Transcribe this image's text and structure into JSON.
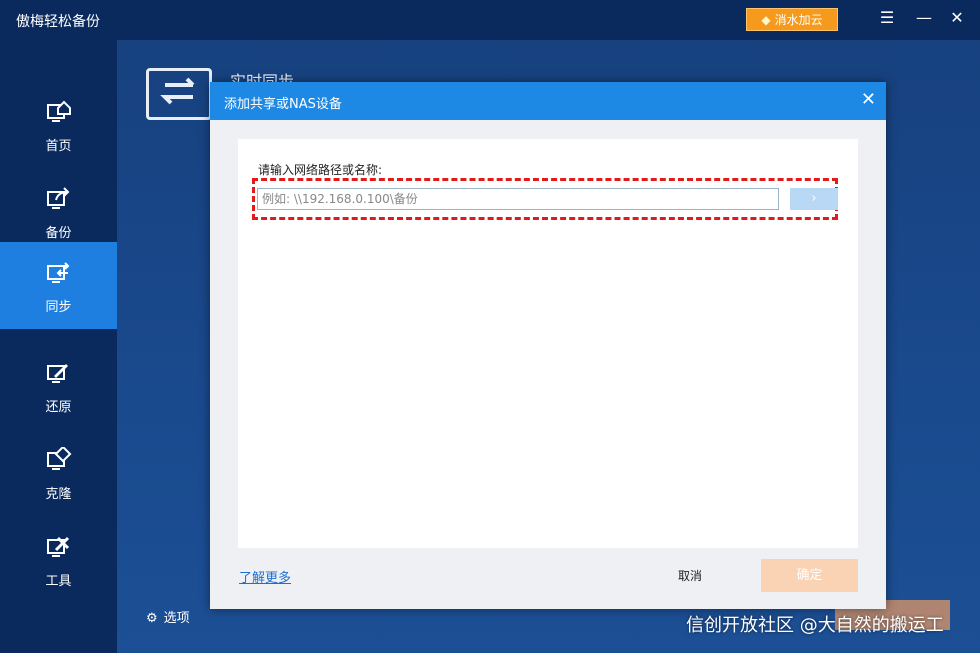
{
  "app": {
    "title": "傲梅轻松备份",
    "upgrade_label": "消水加云",
    "accent": "#1e88e5"
  },
  "window_buttons": {
    "menu": "☰",
    "minimize": "—",
    "close": "✕"
  },
  "sidebar": {
    "items": [
      {
        "label": "首页",
        "icon": "home-monitor-icon"
      },
      {
        "label": "备份",
        "icon": "backup-monitor-icon"
      },
      {
        "label": "同步",
        "icon": "sync-monitor-icon"
      },
      {
        "label": "还原",
        "icon": "restore-monitor-icon"
      },
      {
        "label": "克隆",
        "icon": "clone-monitor-icon"
      },
      {
        "label": "工具",
        "icon": "tools-monitor-icon"
      }
    ],
    "options_label": "选项"
  },
  "background": {
    "page_title": "实时同步"
  },
  "dialog": {
    "title": "添加共享或NAS设备",
    "field_label": "请输入网络路径或名称:",
    "path_placeholder": "例如: \\\\192.168.0.100\\备份",
    "go_label": "›",
    "learn_more": "了解更多",
    "cancel_label": "取消",
    "ok_label": "确定"
  },
  "watermark": "信创开放社区 @大自然的搬运工"
}
